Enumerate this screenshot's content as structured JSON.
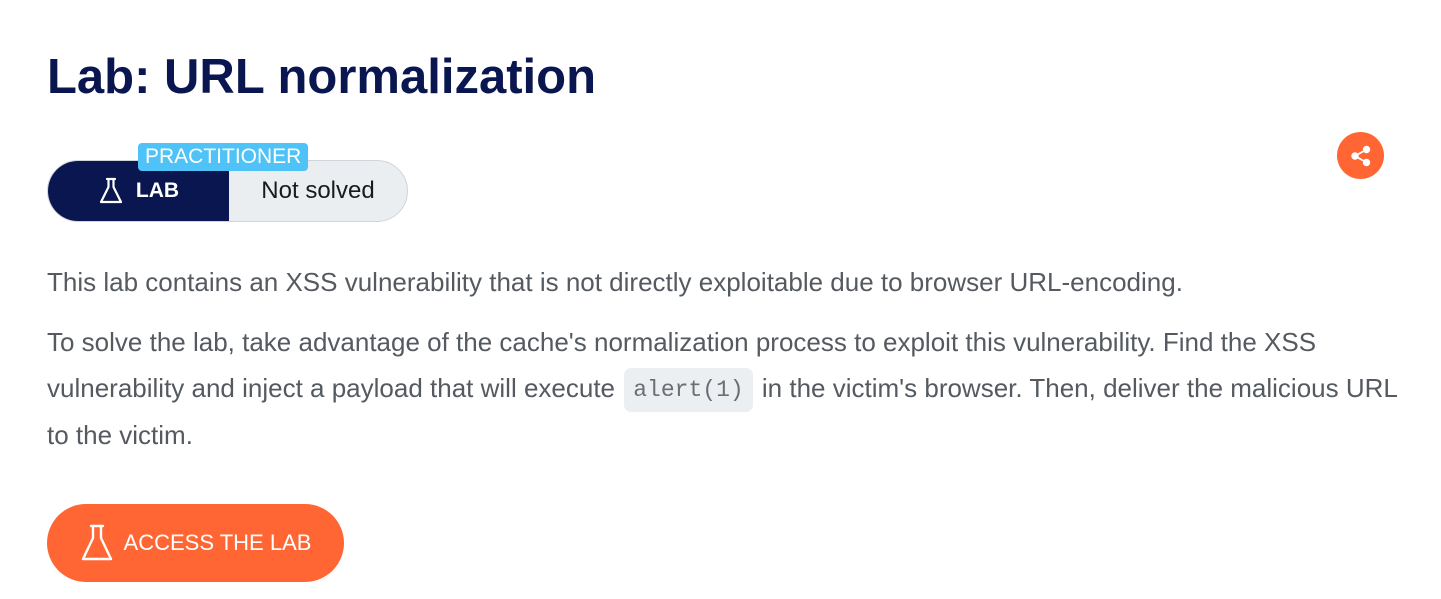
{
  "page": {
    "title": "Lab: URL normalization"
  },
  "status": {
    "level": "PRACTITIONER",
    "type_label": "LAB",
    "state": "Not solved"
  },
  "description": {
    "p1": "This lab contains an XSS vulnerability that is not directly exploitable due to browser URL-encoding.",
    "p2_before": "To solve the lab, take advantage of the cache's normalization process to exploit this vulnerability. Find the XSS vulnerability and inject a payload that will execute",
    "p2_code": "alert(1)",
    "p2_after": "in the victim's browser. Then, deliver the malicious URL to the victim."
  },
  "actions": {
    "access_label": "ACCESS THE LAB",
    "share_icon": "share-icon"
  },
  "colors": {
    "navy": "#0a1650",
    "accent": "#ff6633",
    "badge": "#4fc3f7"
  }
}
